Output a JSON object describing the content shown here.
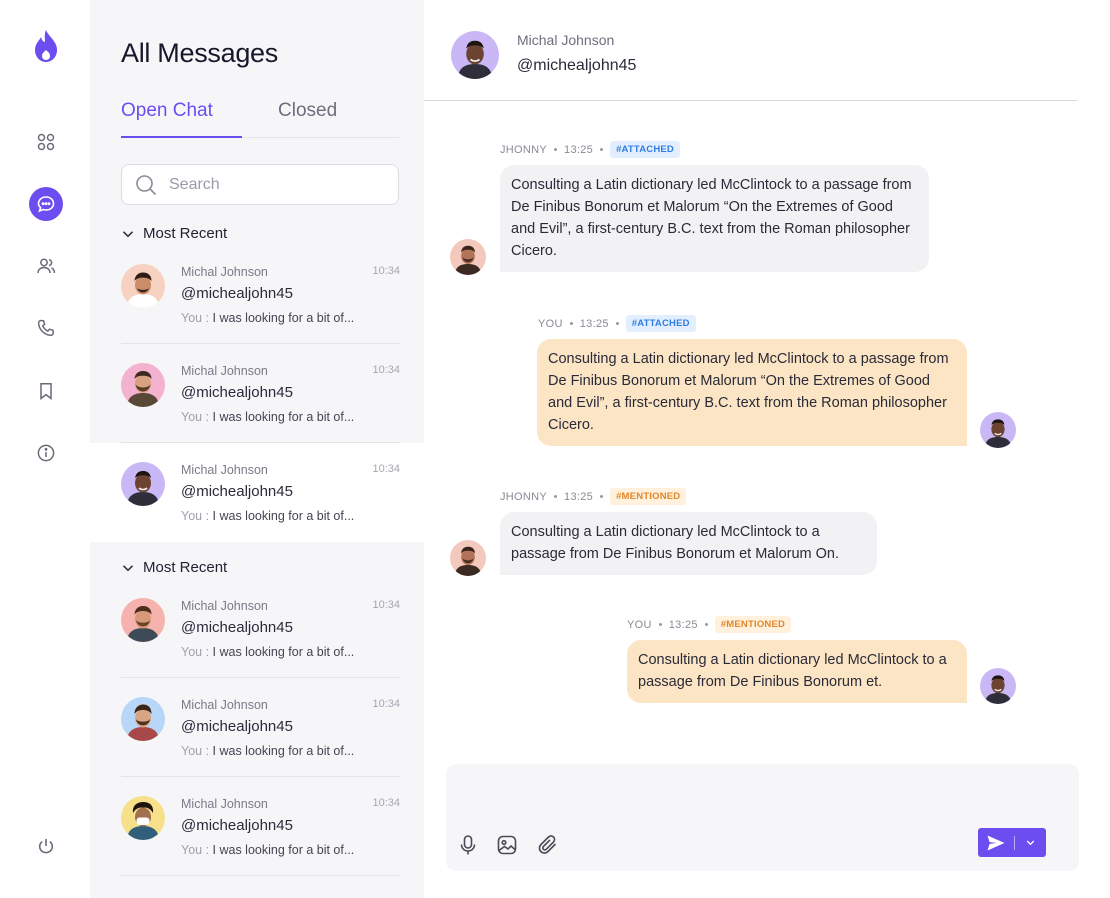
{
  "sidebar": {
    "active": "messages",
    "items": [
      {
        "name": "apps-icon"
      },
      {
        "name": "chat-icon"
      },
      {
        "name": "users-icon"
      },
      {
        "name": "phone-icon"
      },
      {
        "name": "bookmark-icon"
      },
      {
        "name": "info-icon"
      },
      {
        "name": "power-icon"
      }
    ],
    "colors": {
      "accent": "#6c4df0"
    }
  },
  "list": {
    "title": "All Messages",
    "tabs": [
      {
        "label": "Open Chat",
        "active": true
      },
      {
        "label": "Closed",
        "active": false
      }
    ],
    "search": {
      "placeholder": "Search",
      "value": ""
    },
    "groups": [
      {
        "label": "Most Recent",
        "conversations": [
          {
            "name": "Michal Johnson",
            "handle": "@michealjohn45",
            "time": "10:34",
            "you": "You :",
            "preview": "I was looking for a bit of...",
            "avatar_bg": "#f8d2c0"
          },
          {
            "name": "Michal Johnson",
            "handle": "@michealjohn45",
            "time": "10:34",
            "you": "You :",
            "preview": "I was looking for a bit of...",
            "avatar_bg": "#f3b2cf"
          },
          {
            "name": "Michal Johnson",
            "handle": "@michealjohn45",
            "time": "10:34",
            "you": "You :",
            "preview": "I was looking for a bit of...",
            "avatar_bg": "#c9b8f5",
            "selected": true
          }
        ]
      },
      {
        "label": "Most Recent",
        "conversations": [
          {
            "name": "Michal Johnson",
            "handle": "@michealjohn45",
            "time": "10:34",
            "you": "You :",
            "preview": "I was looking for a bit of...",
            "avatar_bg": "#f6b2ad"
          },
          {
            "name": "Michal Johnson",
            "handle": "@michealjohn45",
            "time": "10:34",
            "you": "You :",
            "preview": "I was looking for a bit of...",
            "avatar_bg": "#b8d6f7"
          },
          {
            "name": "Michal Johnson",
            "handle": "@michealjohn45",
            "time": "10:34",
            "you": "You :",
            "preview": "I was looking for a bit of...",
            "avatar_bg": "#f7e08a"
          }
        ]
      }
    ]
  },
  "chat": {
    "header": {
      "name": "Michal Johnson",
      "handle": "@michealjohn45"
    },
    "messages": [
      {
        "sender": "JHONNY",
        "time": "13:25",
        "tag": "#ATTACHED",
        "direction": "in",
        "text": "Consulting a Latin dictionary led McClintock to a passage from De Finibus Bonorum et Malorum “On the Extremes of Good and Evil”, a first-century B.C. text from the Roman philosopher Cicero."
      },
      {
        "sender": "YOU",
        "time": "13:25",
        "tag": "#ATTACHED",
        "direction": "out",
        "text": "Consulting a Latin dictionary led McClintock to a passage from De Finibus Bonorum et Malorum “On the Extremes of Good and Evil”, a first-century B.C. text from the Roman philosopher Cicero."
      },
      {
        "sender": "JHONNY",
        "time": "13:25",
        "tag": "#MENTIONED",
        "direction": "in",
        "text": "Consulting a Latin dictionary led McClintock to a passage from De Finibus Bonorum et Malorum  On."
      },
      {
        "sender": "YOU",
        "time": "13:25",
        "tag": "#MENTIONED",
        "direction": "out",
        "text": "Consulting a Latin dictionary led McClintock to a passage from De Finibus Bonorum et."
      }
    ],
    "composer": {
      "placeholder": "",
      "value": ""
    },
    "colors": {
      "incoming_bubble": "#f2f2f4",
      "outgoing_bubble": "#fbe5c5",
      "attached_tag": "#2f7de1",
      "mentioned_tag": "#e0872a"
    }
  }
}
